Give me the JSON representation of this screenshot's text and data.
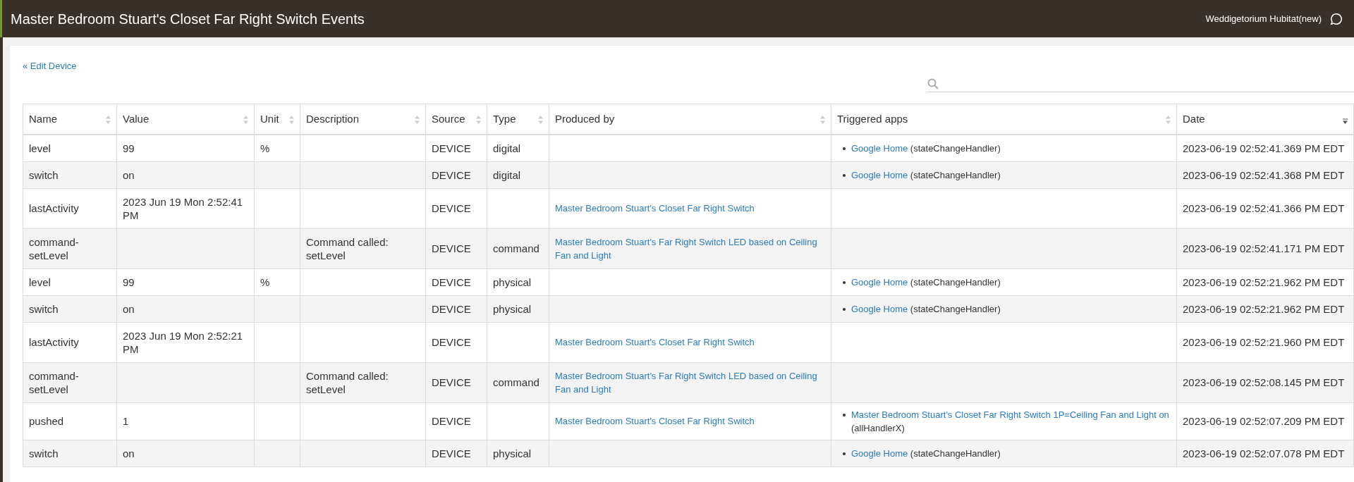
{
  "header": {
    "title": "Master Bedroom Stuart's Closet Far Right Switch Events",
    "hub_name": "Weddigetorium Hubitat(new)"
  },
  "back_link": "« Edit Device",
  "table": {
    "columns": [
      {
        "label": "Name",
        "sorted": false
      },
      {
        "label": "Value",
        "sorted": false
      },
      {
        "label": "Unit",
        "sorted": false
      },
      {
        "label": "Description",
        "sorted": false
      },
      {
        "label": "Source",
        "sorted": false
      },
      {
        "label": "Type",
        "sorted": false
      },
      {
        "label": "Produced by",
        "sorted": false
      },
      {
        "label": "Triggered apps",
        "sorted": false
      },
      {
        "label": "Date",
        "sorted": true
      }
    ],
    "rows": [
      {
        "name": "level",
        "value": "99",
        "unit": "%",
        "description": "",
        "source": "DEVICE",
        "type": "digital",
        "produced_by": "",
        "triggered_apps": [
          {
            "app": "Google Home",
            "handler": "(stateChangeHandler)"
          }
        ],
        "date": "2023-06-19 02:52:41.369 PM EDT"
      },
      {
        "name": "switch",
        "value": "on",
        "unit": "",
        "description": "",
        "source": "DEVICE",
        "type": "digital",
        "produced_by": "",
        "triggered_apps": [
          {
            "app": "Google Home",
            "handler": "(stateChangeHandler)"
          }
        ],
        "date": "2023-06-19 02:52:41.368 PM EDT"
      },
      {
        "name": "lastActivity",
        "value": "2023 Jun 19 Mon 2:52:41 PM",
        "unit": "",
        "description": "",
        "source": "DEVICE",
        "type": "",
        "produced_by": "Master Bedroom Stuart's Closet Far Right Switch",
        "triggered_apps": [],
        "date": "2023-06-19 02:52:41.366 PM EDT"
      },
      {
        "name": "command-setLevel",
        "value": "",
        "unit": "",
        "description": "Command called: setLevel",
        "source": "DEVICE",
        "type": "command",
        "produced_by": "Master Bedroom Stuart's Far Right Switch LED based on Ceiling Fan and Light",
        "triggered_apps": [],
        "date": "2023-06-19 02:52:41.171 PM EDT"
      },
      {
        "name": "level",
        "value": "99",
        "unit": "%",
        "description": "",
        "source": "DEVICE",
        "type": "physical",
        "produced_by": "",
        "triggered_apps": [
          {
            "app": "Google Home",
            "handler": "(stateChangeHandler)"
          }
        ],
        "date": "2023-06-19 02:52:21.962 PM EDT"
      },
      {
        "name": "switch",
        "value": "on",
        "unit": "",
        "description": "",
        "source": "DEVICE",
        "type": "physical",
        "produced_by": "",
        "triggered_apps": [
          {
            "app": "Google Home",
            "handler": "(stateChangeHandler)"
          }
        ],
        "date": "2023-06-19 02:52:21.962 PM EDT"
      },
      {
        "name": "lastActivity",
        "value": "2023 Jun 19 Mon 2:52:21 PM",
        "unit": "",
        "description": "",
        "source": "DEVICE",
        "type": "",
        "produced_by": "Master Bedroom Stuart's Closet Far Right Switch",
        "triggered_apps": [],
        "date": "2023-06-19 02:52:21.960 PM EDT"
      },
      {
        "name": "command-setLevel",
        "value": "",
        "unit": "",
        "description": "Command called: setLevel",
        "source": "DEVICE",
        "type": "command",
        "produced_by": "Master Bedroom Stuart's Far Right Switch LED based on Ceiling Fan and Light",
        "triggered_apps": [],
        "date": "2023-06-19 02:52:08.145 PM EDT"
      },
      {
        "name": "pushed",
        "value": "1",
        "unit": "",
        "description": "",
        "source": "DEVICE",
        "type": "",
        "produced_by": "Master Bedroom Stuart's Closet Far Right Switch",
        "triggered_apps": [
          {
            "app": "Master Bedroom Stuart's Closet Far Right Switch 1P=Ceiling Fan and Light on",
            "handler": "(allHandlerX)"
          }
        ],
        "date": "2023-06-19 02:52:07.209 PM EDT"
      },
      {
        "name": "switch",
        "value": "on",
        "unit": "",
        "description": "",
        "source": "DEVICE",
        "type": "physical",
        "produced_by": "",
        "triggered_apps": [
          {
            "app": "Google Home",
            "handler": "(stateChangeHandler)"
          }
        ],
        "date": "2023-06-19 02:52:07.078 PM EDT"
      }
    ]
  }
}
